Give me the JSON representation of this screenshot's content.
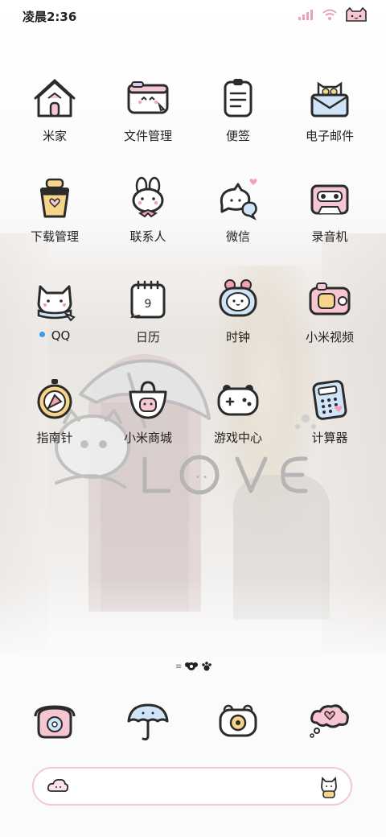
{
  "status_bar": {
    "time": "凌晨2:36",
    "icons": [
      "signal-icon",
      "wifi-icon",
      "cat-battery-icon"
    ]
  },
  "apps": [
    {
      "label": "米家",
      "icon": "house-icon"
    },
    {
      "label": "文件管理",
      "icon": "folder-icon"
    },
    {
      "label": "便签",
      "icon": "notepad-icon"
    },
    {
      "label": "电子邮件",
      "icon": "envelope-cat-icon"
    },
    {
      "label": "下载管理",
      "icon": "download-box-icon"
    },
    {
      "label": "联系人",
      "icon": "bunny-contacts-icon"
    },
    {
      "label": "微信",
      "icon": "cat-chat-icon"
    },
    {
      "label": "录音机",
      "icon": "cassette-icon"
    },
    {
      "label": "QQ",
      "icon": "cat-scarf-icon",
      "notification_dot": true
    },
    {
      "label": "日历",
      "icon": "calendar-icon",
      "calendar_day": "9"
    },
    {
      "label": "时钟",
      "icon": "alarm-clock-icon"
    },
    {
      "label": "小米视频",
      "icon": "camera-icon"
    },
    {
      "label": "指南针",
      "icon": "compass-icon"
    },
    {
      "label": "小米商城",
      "icon": "shopping-bag-icon"
    },
    {
      "label": "游戏中心",
      "icon": "gamepad-icon"
    },
    {
      "label": "计算器",
      "icon": "calculator-icon"
    }
  ],
  "wallpaper_text": "LOVE",
  "dock": [
    {
      "icon": "telephone-icon"
    },
    {
      "icon": "umbrella-icon"
    },
    {
      "icon": "photo-camera-icon"
    },
    {
      "icon": "heart-cloud-icon"
    }
  ],
  "colors": {
    "accent_pink": "#f3c9d3",
    "notification_dot": "#3a9bf0",
    "icon_outline": "#2b2b2b"
  }
}
